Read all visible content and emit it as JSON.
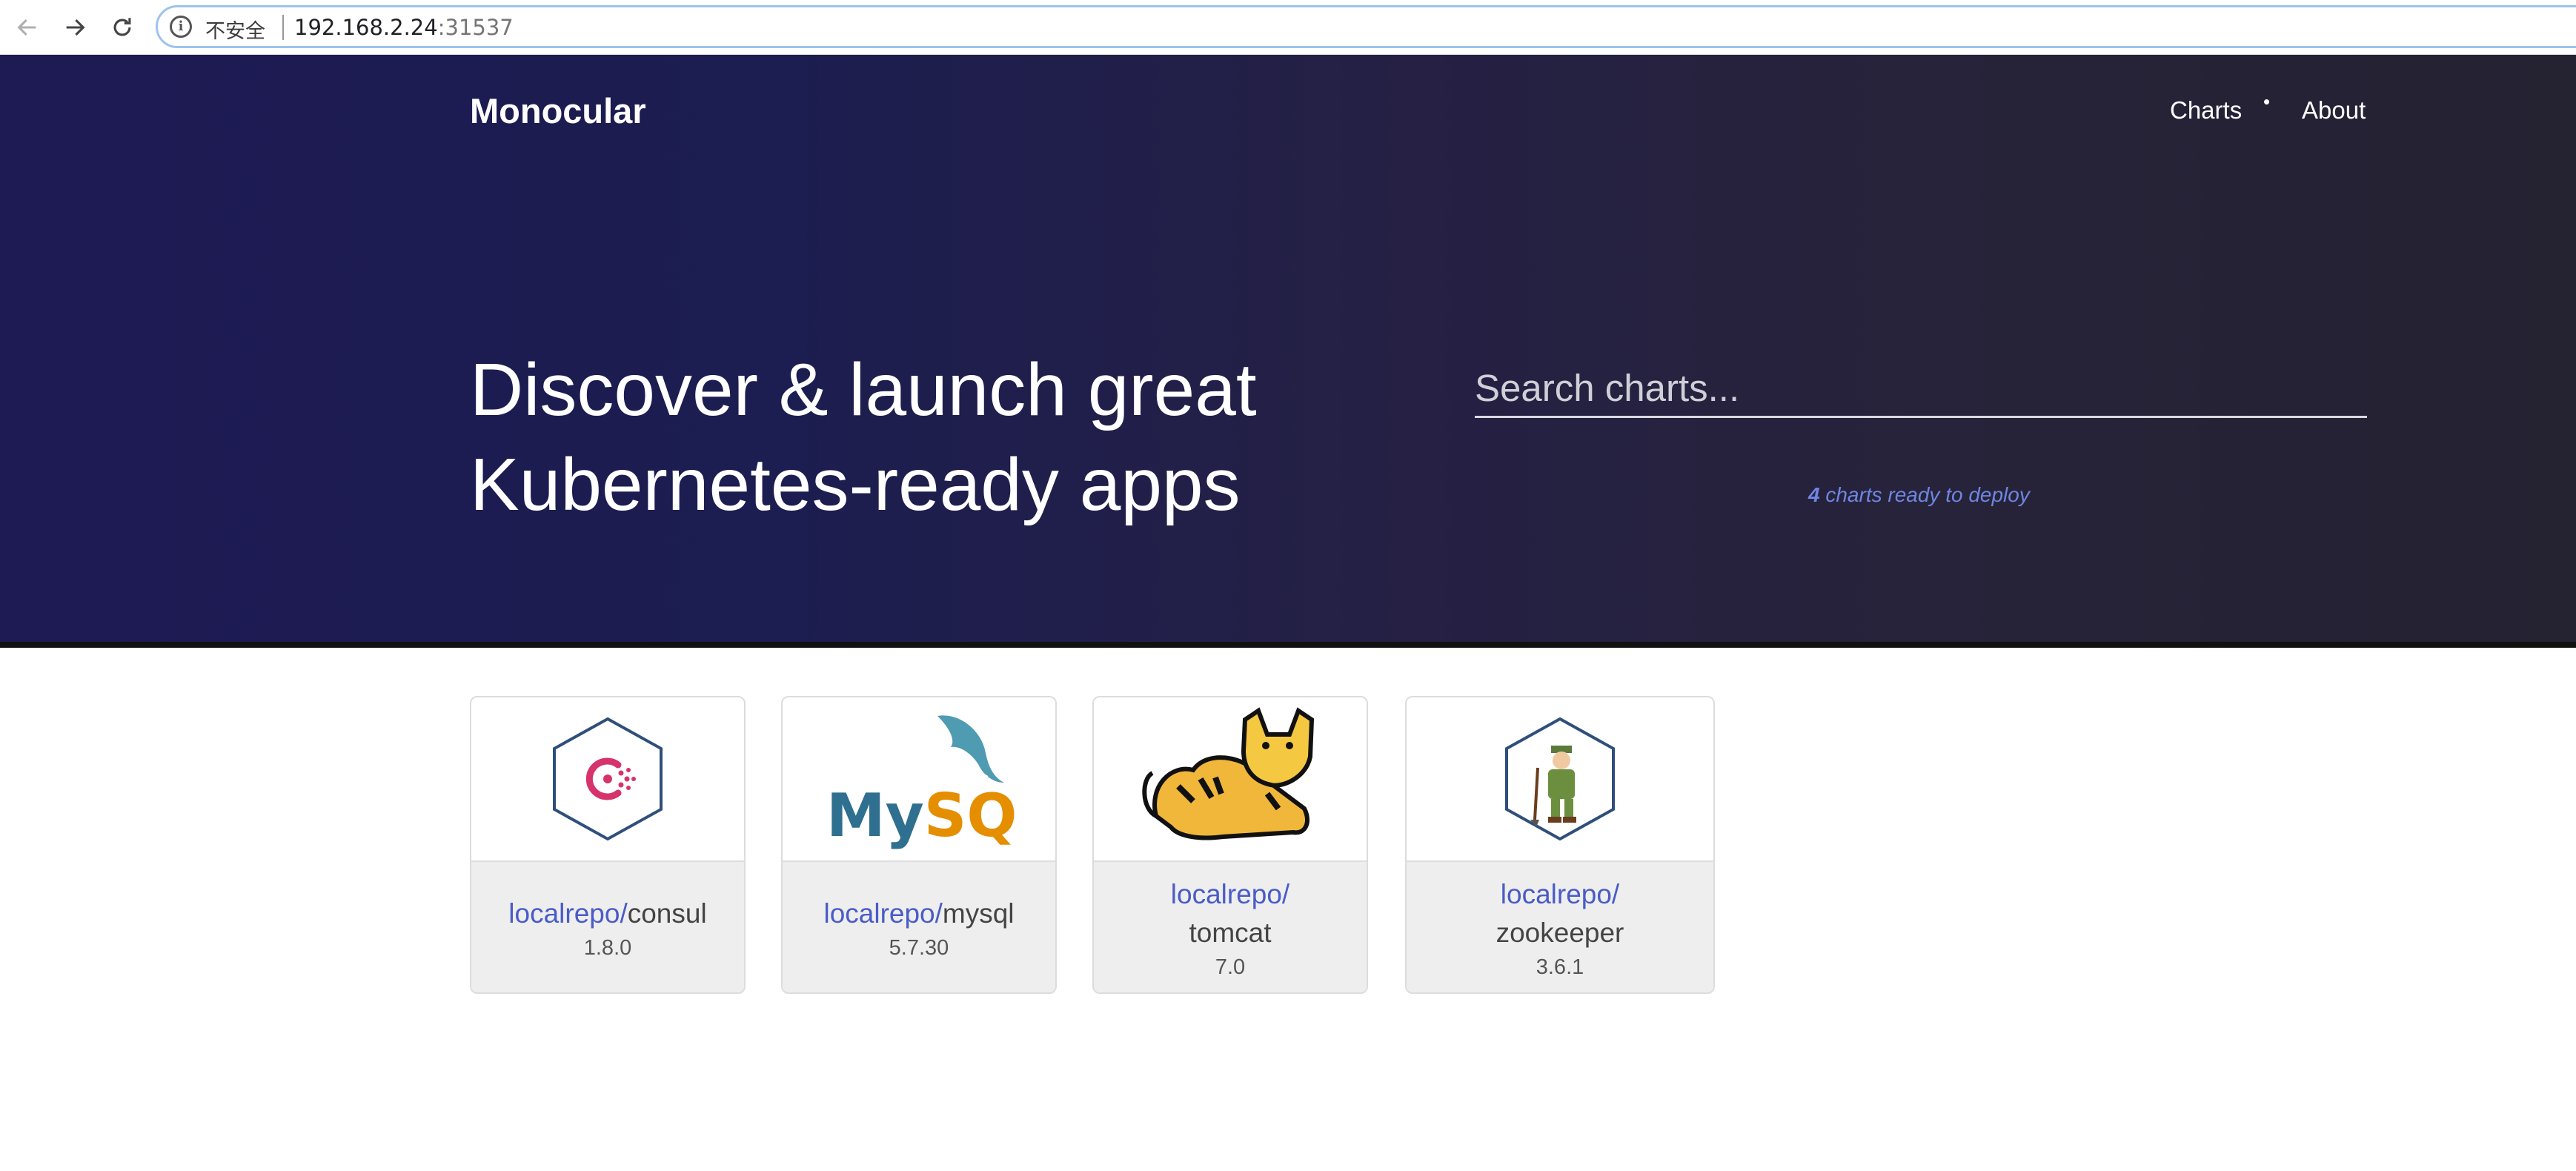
{
  "browser": {
    "security_label": "不安全",
    "url_host": "192.168.2.24",
    "url_port": ":31537"
  },
  "header": {
    "brand": "Monocular",
    "nav": [
      {
        "label": "Charts"
      },
      {
        "label": "About"
      }
    ],
    "separator": "•"
  },
  "hero": {
    "headline_line1": "Discover & launch great",
    "headline_line2": "Kubernetes-ready apps",
    "search": {
      "placeholder": "Search charts...",
      "value": ""
    },
    "count_number": "4",
    "count_text": " charts ready to deploy"
  },
  "charts": [
    {
      "repo": "localrepo/",
      "name": "consul",
      "version": "1.8.0",
      "icon": "consul-logo-icon"
    },
    {
      "repo": "localrepo/",
      "name": "mysql",
      "version": "5.7.30",
      "icon": "mysql-logo-icon",
      "logo_text": "MySQL"
    },
    {
      "repo": "localrepo/",
      "name": "tomcat",
      "version": "7.0",
      "icon": "tomcat-logo-icon"
    },
    {
      "repo": "localrepo/",
      "name": "zookeeper",
      "version": "3.6.1",
      "icon": "zookeeper-logo-icon"
    }
  ],
  "colors": {
    "hero_bg": "#1e1a54",
    "link_blue": "#4a5cc6",
    "card_footer": "#eeeeee",
    "consul_pink": "#d6336c",
    "hex_border": "#2f4f7a"
  }
}
